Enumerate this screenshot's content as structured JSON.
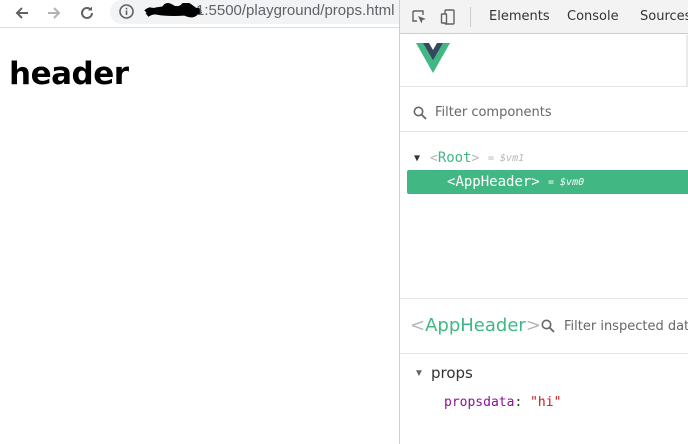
{
  "browser": {
    "url": "1:5500/playground/props.html",
    "page_heading": "header"
  },
  "devtools": {
    "tabs": [
      "Elements",
      "Console",
      "Sources"
    ],
    "filter_components_placeholder": "Filter components",
    "tree": {
      "root": {
        "open": "<",
        "name": "Root",
        "close": ">",
        "vm": "= $vm1"
      },
      "selected": {
        "open": "<",
        "name": "AppHeader",
        "close": ">",
        "vm": "= $vm0"
      }
    },
    "inspector": {
      "open": "<",
      "component_name": "AppHeader",
      "close": ">",
      "filter_placeholder": "Filter inspected data",
      "section_label": "props",
      "props": [
        {
          "key": "propsdata",
          "colon": ":",
          "value": "\"hi\""
        }
      ]
    }
  },
  "colors": {
    "vue_green": "#41b883",
    "vue_dark": "#35495e"
  }
}
